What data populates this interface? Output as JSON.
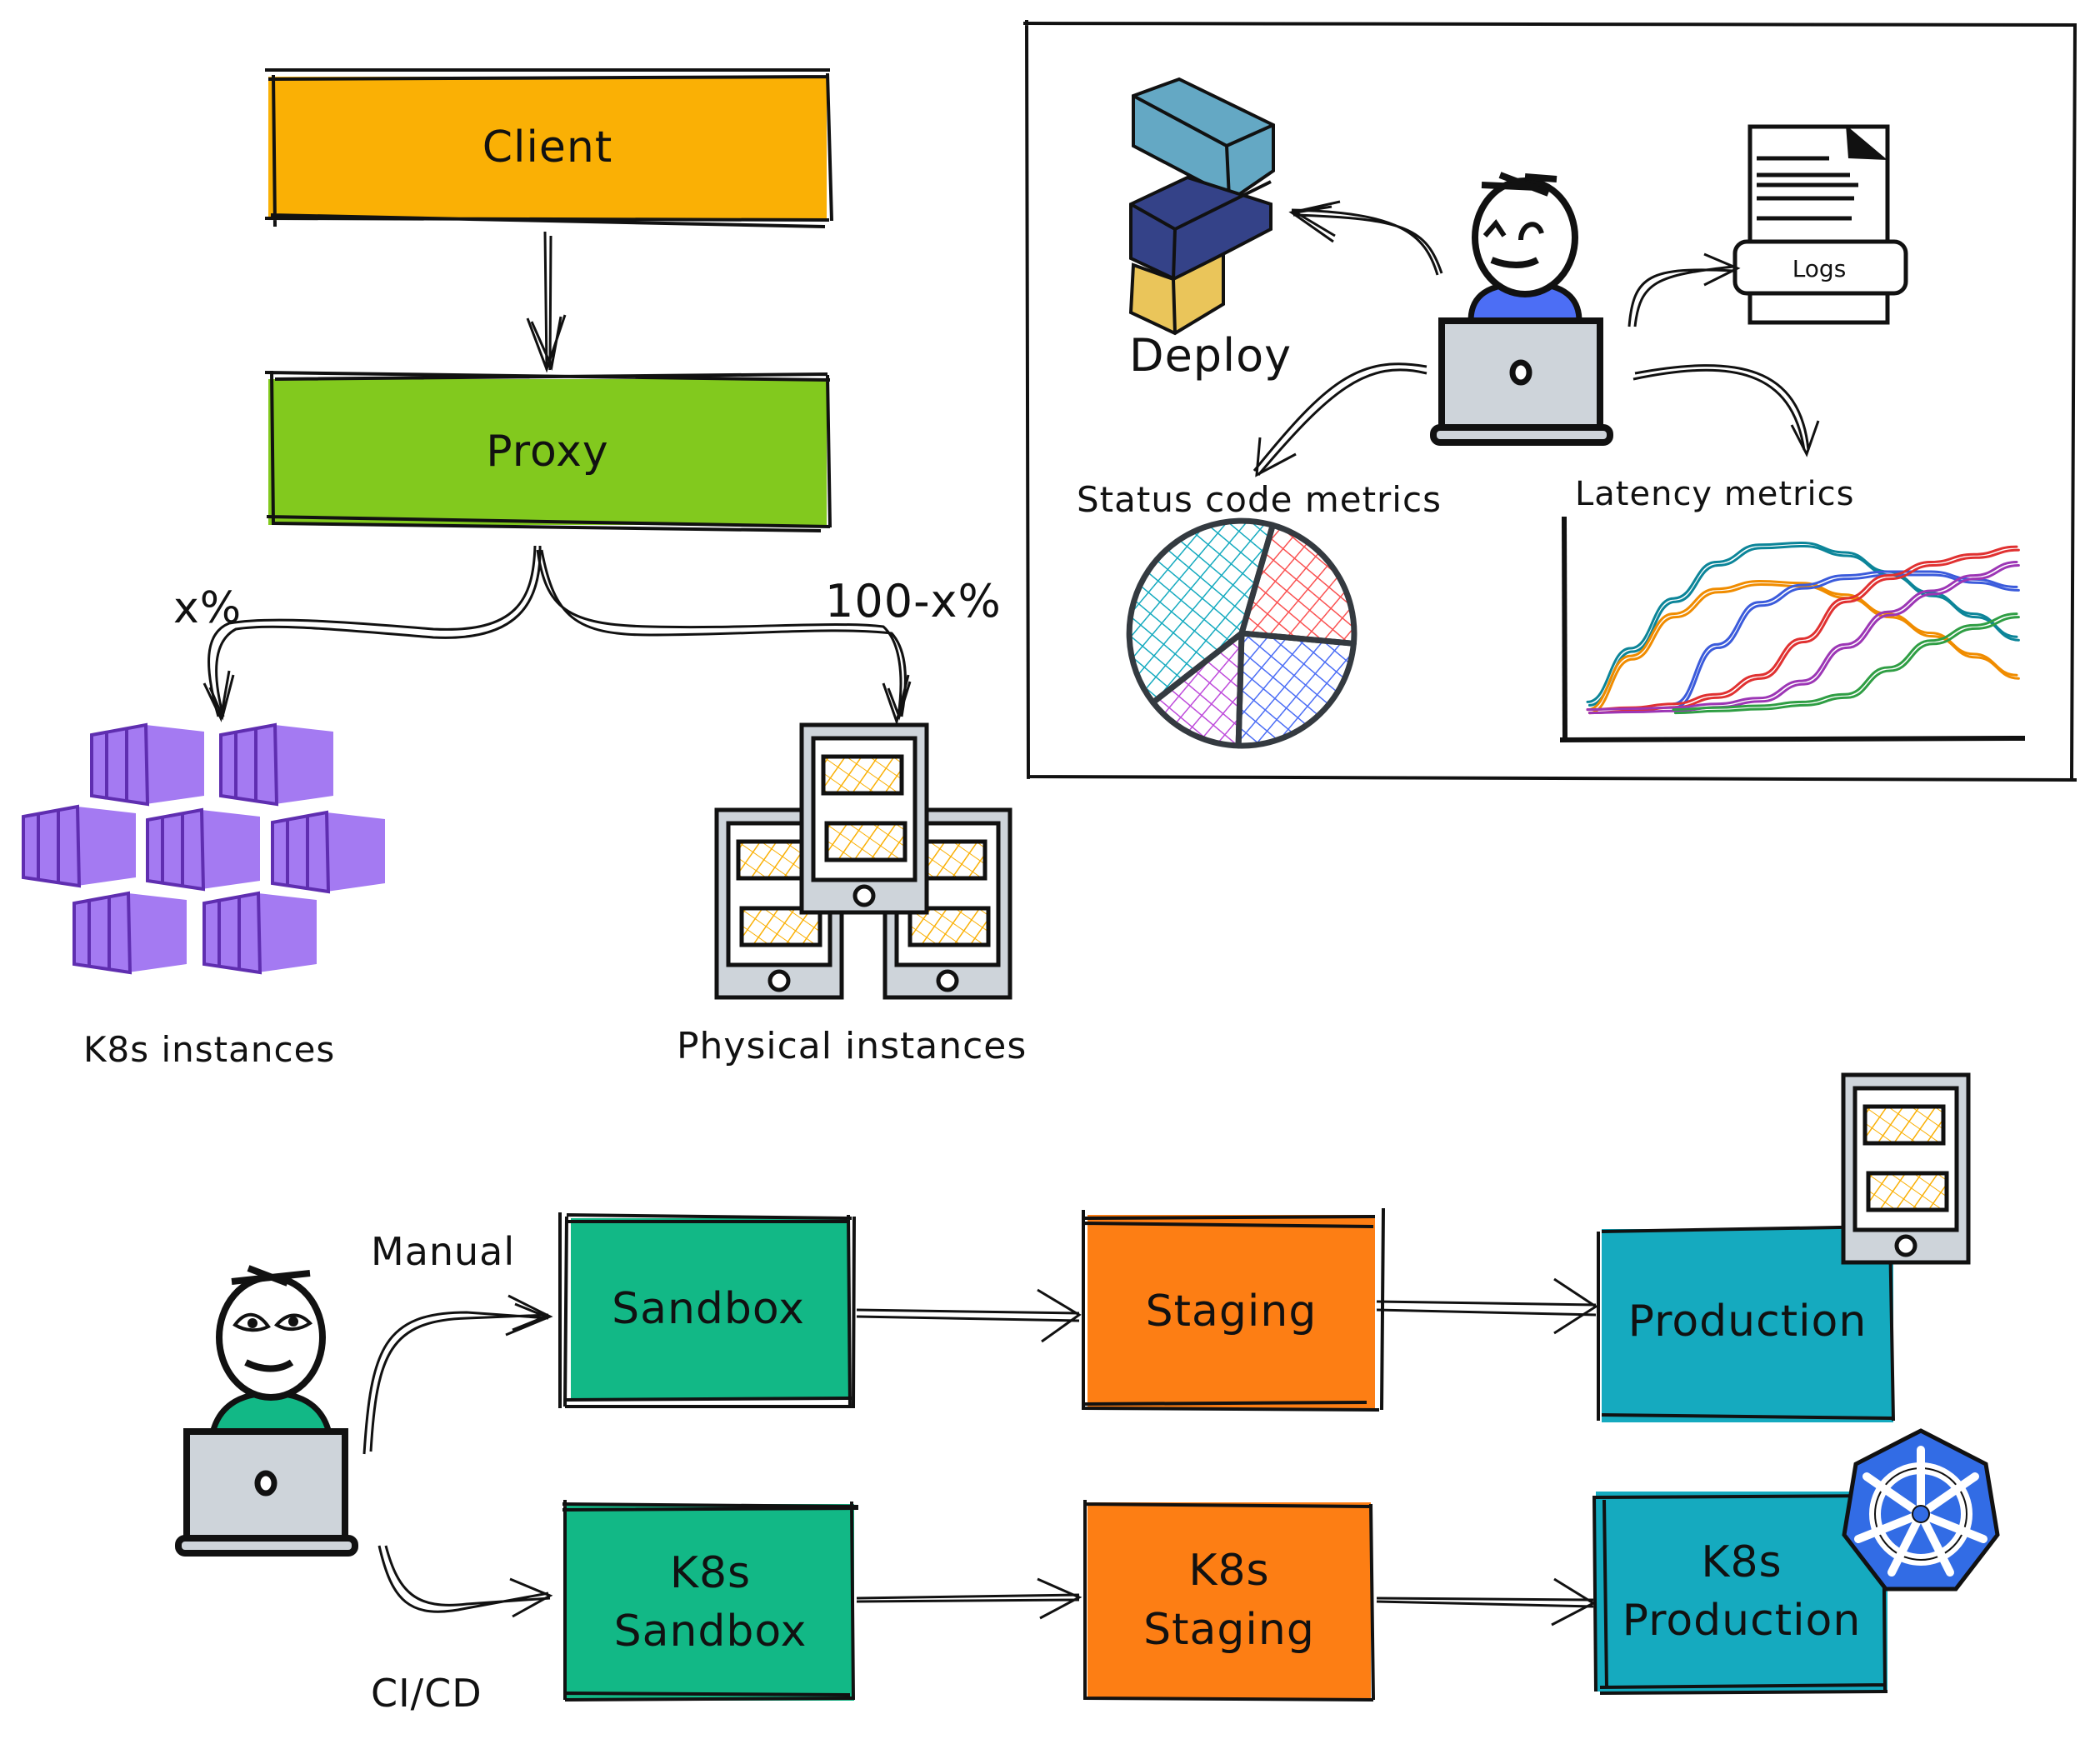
{
  "diagram": {
    "top_flow": {
      "client": {
        "label": "Client",
        "color": "#FAB005"
      },
      "proxy": {
        "label": "Proxy",
        "color": "#82C91E"
      },
      "split_left_label": "x%",
      "split_right_label": "100-x%",
      "k8s_instances": {
        "label": "K8s instances",
        "color": "#A47AF2",
        "count": 7
      },
      "physical_instances": {
        "label": "Physical instances",
        "count": 3
      }
    },
    "monitoring_panel": {
      "deploy": {
        "label": "Deploy",
        "colors": [
          "#64A8C4",
          "#344288",
          "#EAC55A"
        ]
      },
      "logs": {
        "label": "Logs"
      },
      "status_metrics": {
        "label": "Status code metrics"
      },
      "latency_metrics": {
        "label": "Latency metrics"
      },
      "person_shirt_color": "#4C6EF5"
    },
    "pipeline": {
      "manual_label": "Manual",
      "cicd_label": "CI/CD",
      "person_shirt_color": "#12B886",
      "manual_row": [
        {
          "label": "Sandbox",
          "color": "#12B886"
        },
        {
          "label": "Staging",
          "color": "#FD7E14"
        },
        {
          "label": "Production",
          "color": "#15AABF"
        }
      ],
      "k8s_row": [
        {
          "label_line1": "K8s",
          "label_line2": "Sandbox",
          "color": "#12B886"
        },
        {
          "label_line1": "K8s",
          "label_line2": "Staging",
          "color": "#FD7E14"
        },
        {
          "label_line1": "K8s",
          "label_line2": "Production",
          "color": "#15AABF"
        }
      ],
      "k8s_badge_color": "#326CE5"
    }
  },
  "chart_data": [
    {
      "type": "pie",
      "title": "Status code metrics",
      "categories": [
        "teal",
        "red",
        "blue",
        "purple"
      ],
      "values": [
        40,
        22,
        24,
        14
      ],
      "colors": [
        "#15AABF",
        "#FA5252",
        "#4C6EF5",
        "#BE4BDB"
      ]
    },
    {
      "type": "line",
      "title": "Latency metrics",
      "xlabel": "",
      "ylabel": "",
      "x": [
        0,
        1,
        2,
        3,
        4,
        5,
        6,
        7,
        8,
        9,
        10
      ],
      "ylim": [
        0,
        10
      ],
      "series": [
        {
          "name": "teal",
          "color": "#0C8599",
          "values": [
            1.2,
            4.0,
            6.6,
            8.5,
            9.4,
            9.5,
            9.0,
            8.0,
            6.9,
            5.8,
            4.6
          ]
        },
        {
          "name": "orange",
          "color": "#F08C00",
          "values": [
            0.8,
            3.6,
            5.8,
            7.1,
            7.5,
            7.4,
            6.8,
            5.8,
            4.8,
            3.7,
            2.6
          ]
        },
        {
          "name": "blue",
          "color": "#3B5BDB",
          "values": [
            null,
            null,
            1.1,
            4.2,
            6.4,
            7.3,
            7.8,
            8.0,
            8.0,
            7.6,
            7.2
          ]
        },
        {
          "name": "red",
          "color": "#E03131",
          "values": [
            0.8,
            0.9,
            1.1,
            1.6,
            2.6,
            4.5,
            6.6,
            7.8,
            8.5,
            8.9,
            9.3
          ]
        },
        {
          "name": "purple",
          "color": "#9C36B5",
          "values": [
            0.8,
            0.85,
            0.9,
            1.1,
            1.4,
            2.3,
            4.2,
            5.9,
            7.0,
            7.8,
            8.5
          ]
        },
        {
          "name": "green",
          "color": "#2F9E44",
          "values": [
            null,
            null,
            0.8,
            0.9,
            1.0,
            1.2,
            1.6,
            3.0,
            4.4,
            5.2,
            5.8
          ]
        }
      ]
    }
  ]
}
